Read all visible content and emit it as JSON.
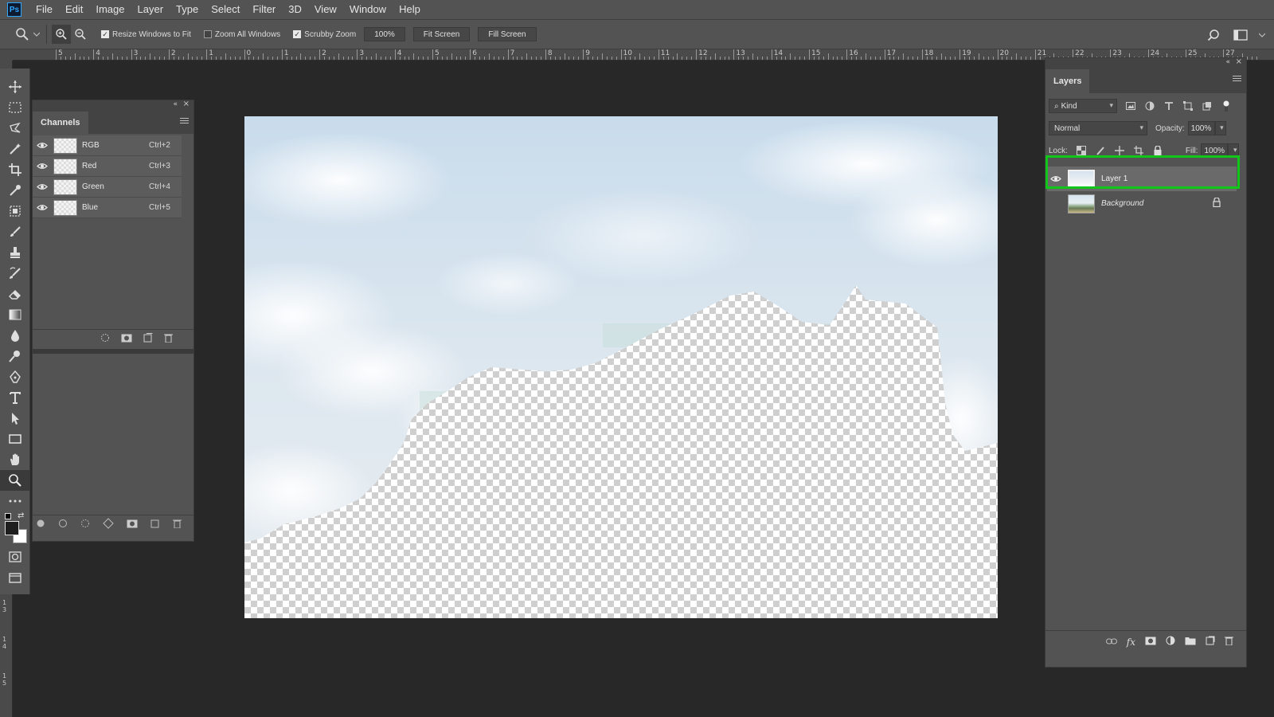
{
  "app": {
    "logo": "Ps"
  },
  "menu": [
    "File",
    "Edit",
    "Image",
    "Layer",
    "Type",
    "Select",
    "Filter",
    "3D",
    "View",
    "Window",
    "Help"
  ],
  "options": {
    "resize_windows_label": "Resize Windows to Fit",
    "resize_windows_checked": true,
    "zoom_all_label": "Zoom All Windows",
    "zoom_all_checked": false,
    "scrubby_label": "Scrubby Zoom",
    "scrubby_checked": true,
    "zoom_value": "100%",
    "fit_screen": "Fit Screen",
    "fill_screen": "Fill Screen"
  },
  "ruler": {
    "top_labels": [
      "5",
      "4",
      "3",
      "2",
      "1",
      "0",
      "1",
      "2",
      "3",
      "4",
      "5",
      "6",
      "7",
      "8",
      "9",
      "10",
      "11",
      "12",
      "13",
      "14",
      "15",
      "16",
      "17",
      "18",
      "19",
      "20",
      "21",
      "22",
      "23",
      "24",
      "25",
      "27"
    ],
    "left_labels": [
      "1 3",
      "1 4",
      "1 5"
    ]
  },
  "tools": [
    "move-tool",
    "marquee-tool",
    "lasso-tool",
    "magic-wand-tool",
    "crop-tool",
    "eyedropper-tool",
    "frame-tool",
    "brush-tool",
    "stamp-tool",
    "history-brush-tool",
    "eraser-tool",
    "gradient-tool",
    "blur-tool",
    "dodge-tool",
    "pen-tool",
    "type-tool",
    "path-selection-tool",
    "rectangle-tool",
    "hand-tool",
    "zoom-tool",
    "more-tools"
  ],
  "active_tool": "zoom-tool",
  "colors": {
    "foreground": "#1e1e1e",
    "background": "#ffffff",
    "highlight": "#11c51b",
    "panel": "#535353"
  },
  "channels": {
    "title": "Channels",
    "rows": [
      {
        "name": "RGB",
        "shortcut": "Ctrl+2"
      },
      {
        "name": "Red",
        "shortcut": "Ctrl+3"
      },
      {
        "name": "Green",
        "shortcut": "Ctrl+4"
      },
      {
        "name": "Blue",
        "shortcut": "Ctrl+5"
      }
    ]
  },
  "layers": {
    "title": "Layers",
    "filter_kind": "Kind",
    "blend_mode": "Normal",
    "opacity_label": "Opacity:",
    "opacity_value": "100%",
    "lock_label": "Lock:",
    "fill_label": "Fill:",
    "fill_value": "100%",
    "items": [
      {
        "name": "Layer 1",
        "visible": true,
        "selected": true
      },
      {
        "name": "Background",
        "visible": false,
        "selected": false,
        "locked": true
      }
    ]
  }
}
